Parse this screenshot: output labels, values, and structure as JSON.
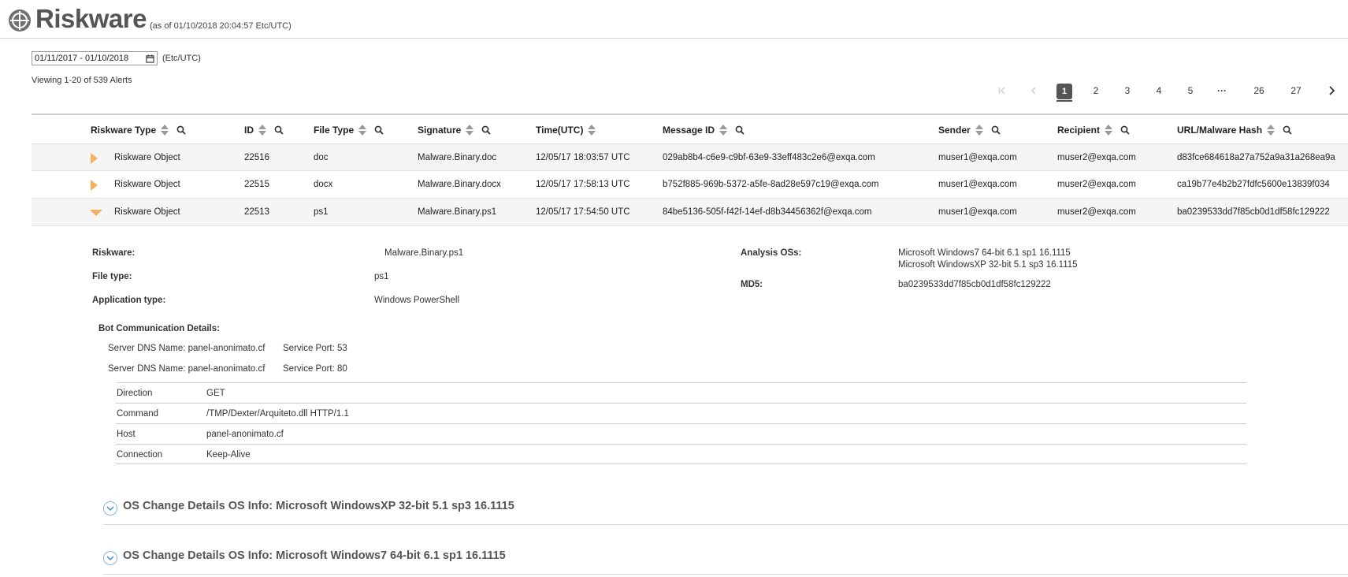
{
  "header": {
    "title": "Riskware",
    "as_of": "(as of 01/10/2018 20:04:57 Etc/UTC)"
  },
  "filter": {
    "date_range": "01/11/2017 - 01/10/2018",
    "timezone": "(Etc/UTC)",
    "viewing": "Viewing 1-20 of 539 Alerts"
  },
  "pagination": {
    "current": "1",
    "pages": [
      "1",
      "2",
      "3",
      "4",
      "5",
      "···",
      "26",
      "27"
    ]
  },
  "table": {
    "columns": [
      "Riskware Type",
      "ID",
      "File Type",
      "Signature",
      "Time(UTC)",
      "Message ID",
      "Sender",
      "Recipient",
      "URL/Malware Hash"
    ],
    "rows": [
      {
        "type": "Riskware Object",
        "id": "22516",
        "file_type": "doc",
        "signature": "Malware.Binary.doc",
        "time": "12/05/17 18:03:57 UTC",
        "message_id": "029ab8b4-c6e9-c9bf-63e9-33eff483c2e6@exqa.com",
        "sender": "muser1@exqa.com",
        "recipient": "muser2@exqa.com",
        "hash": "d83fce684618a27a752a9a31a268ea9a"
      },
      {
        "type": "Riskware Object",
        "id": "22515",
        "file_type": "docx",
        "signature": "Malware.Binary.docx",
        "time": "12/05/17 17:58:13 UTC",
        "message_id": "b752f885-969b-5372-a5fe-8ad28e597c19@exqa.com",
        "sender": "muser1@exqa.com",
        "recipient": "muser2@exqa.com",
        "hash": "ca19b77e4b2b27fdfc5600e13839f034"
      },
      {
        "type": "Riskware Object",
        "id": "22513",
        "file_type": "ps1",
        "signature": "Malware.Binary.ps1",
        "time": "12/05/17 17:54:50 UTC",
        "message_id": "84be5136-505f-f42f-14ef-d8b34456362f@exqa.com",
        "sender": "muser1@exqa.com",
        "recipient": "muser2@exqa.com",
        "hash": "ba0239533dd7f85cb0d1df58fc129222"
      }
    ]
  },
  "details": {
    "riskware_label": "Riskware:",
    "riskware_value": "Malware.Binary.ps1",
    "file_type_label": "File type:",
    "file_type_value": "ps1",
    "app_type_label": "Application type:",
    "app_type_value": "Windows PowerShell",
    "analysis_os_label": "Analysis OSs:",
    "analysis_os_values": [
      "Microsoft Windows7 64-bit 6.1 sp1 16.1115",
      "Microsoft WindowsXP 32-bit 5.1 sp3 16.1115"
    ],
    "md5_label": "MD5:",
    "md5_value": "ba0239533dd7f85cb0d1df58fc129222",
    "bot_title": "Bot Communication Details:",
    "servers": [
      {
        "dns": "Server DNS Name: panel-anonimato.cf",
        "port": "Service Port: 53"
      },
      {
        "dns": "Server DNS Name: panel-anonimato.cf",
        "port": "Service Port: 80"
      }
    ],
    "http": [
      {
        "key": "Direction",
        "value": "GET"
      },
      {
        "key": "Command",
        "value": "/TMP/Dexter/Arquiteto.dll HTTP/1.1"
      },
      {
        "key": "Host",
        "value": "panel-anonimato.cf"
      },
      {
        "key": "Connection",
        "value": "Keep-Alive"
      }
    ]
  },
  "sections": [
    {
      "title": "OS Change Details OS Info: Microsoft WindowsXP 32-bit 5.1 sp3 16.1115"
    },
    {
      "title": "OS Change Details OS Info: Microsoft Windows7 64-bit 6.1 sp1 16.1115"
    }
  ],
  "colors": {
    "accent_orange": "#f5b162",
    "active_page": "#555555",
    "header_text": "#555555"
  },
  "icons": {
    "logo": "crosshair-globe-icon",
    "calendar": "calendar-icon",
    "search": "search-icon",
    "sort": "sort-icon",
    "expand": "expand-triangle-icon",
    "collapse": "chevron-down-circle-icon"
  }
}
